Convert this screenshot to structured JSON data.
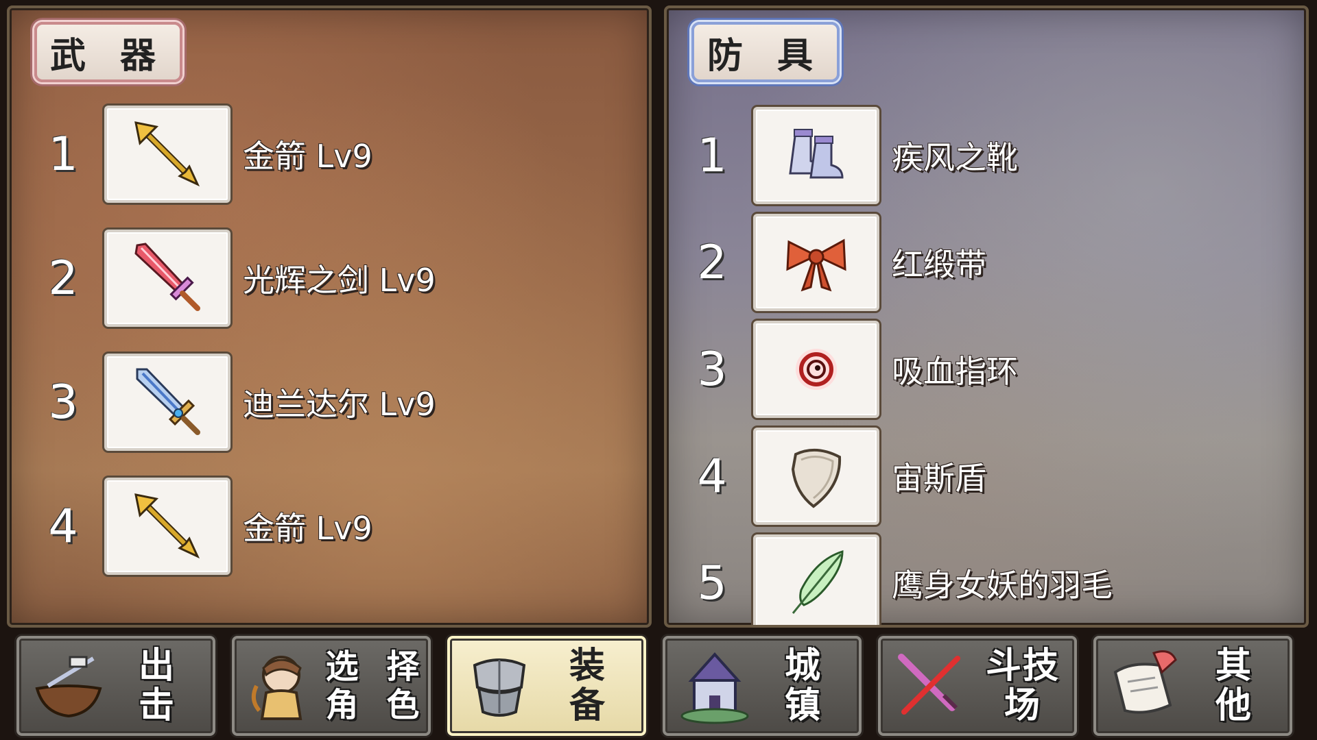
{
  "weapons": {
    "title": "武 器",
    "items": [
      {
        "index": "1",
        "name": "金箭 Lv9",
        "icon": "golden-arrow-icon"
      },
      {
        "index": "2",
        "name": "光辉之剑 Lv9",
        "icon": "radiant-sword-icon"
      },
      {
        "index": "3",
        "name": "迪兰达尔 Lv9",
        "icon": "durandal-sword-icon"
      },
      {
        "index": "4",
        "name": "金箭 Lv9",
        "icon": "golden-arrow-icon"
      }
    ]
  },
  "armor": {
    "title": "防 具",
    "items": [
      {
        "index": "1",
        "name": "疾风之靴",
        "icon": "boots-icon"
      },
      {
        "index": "2",
        "name": "红缎带",
        "icon": "red-ribbon-icon"
      },
      {
        "index": "3",
        "name": "吸血指环",
        "icon": "ring-icon"
      },
      {
        "index": "4",
        "name": "宙斯盾",
        "icon": "shield-icon"
      },
      {
        "index": "5",
        "name": "鹰身女妖的羽毛",
        "icon": "feather-icon"
      }
    ]
  },
  "nav": {
    "sortie": {
      "label": "出 击",
      "icon": "ship-icon"
    },
    "select_character": {
      "label_line1": "选 择",
      "label_line2": "角 色",
      "icon": "character-icon"
    },
    "equipment": {
      "label": "装 备",
      "icon": "armor-icon",
      "active": true
    },
    "town": {
      "label": "城 镇",
      "icon": "castle-icon"
    },
    "arena": {
      "label": "斗技场",
      "icon": "crossed-swords-icon"
    },
    "other": {
      "label": "其 他",
      "icon": "scroll-icon"
    }
  }
}
